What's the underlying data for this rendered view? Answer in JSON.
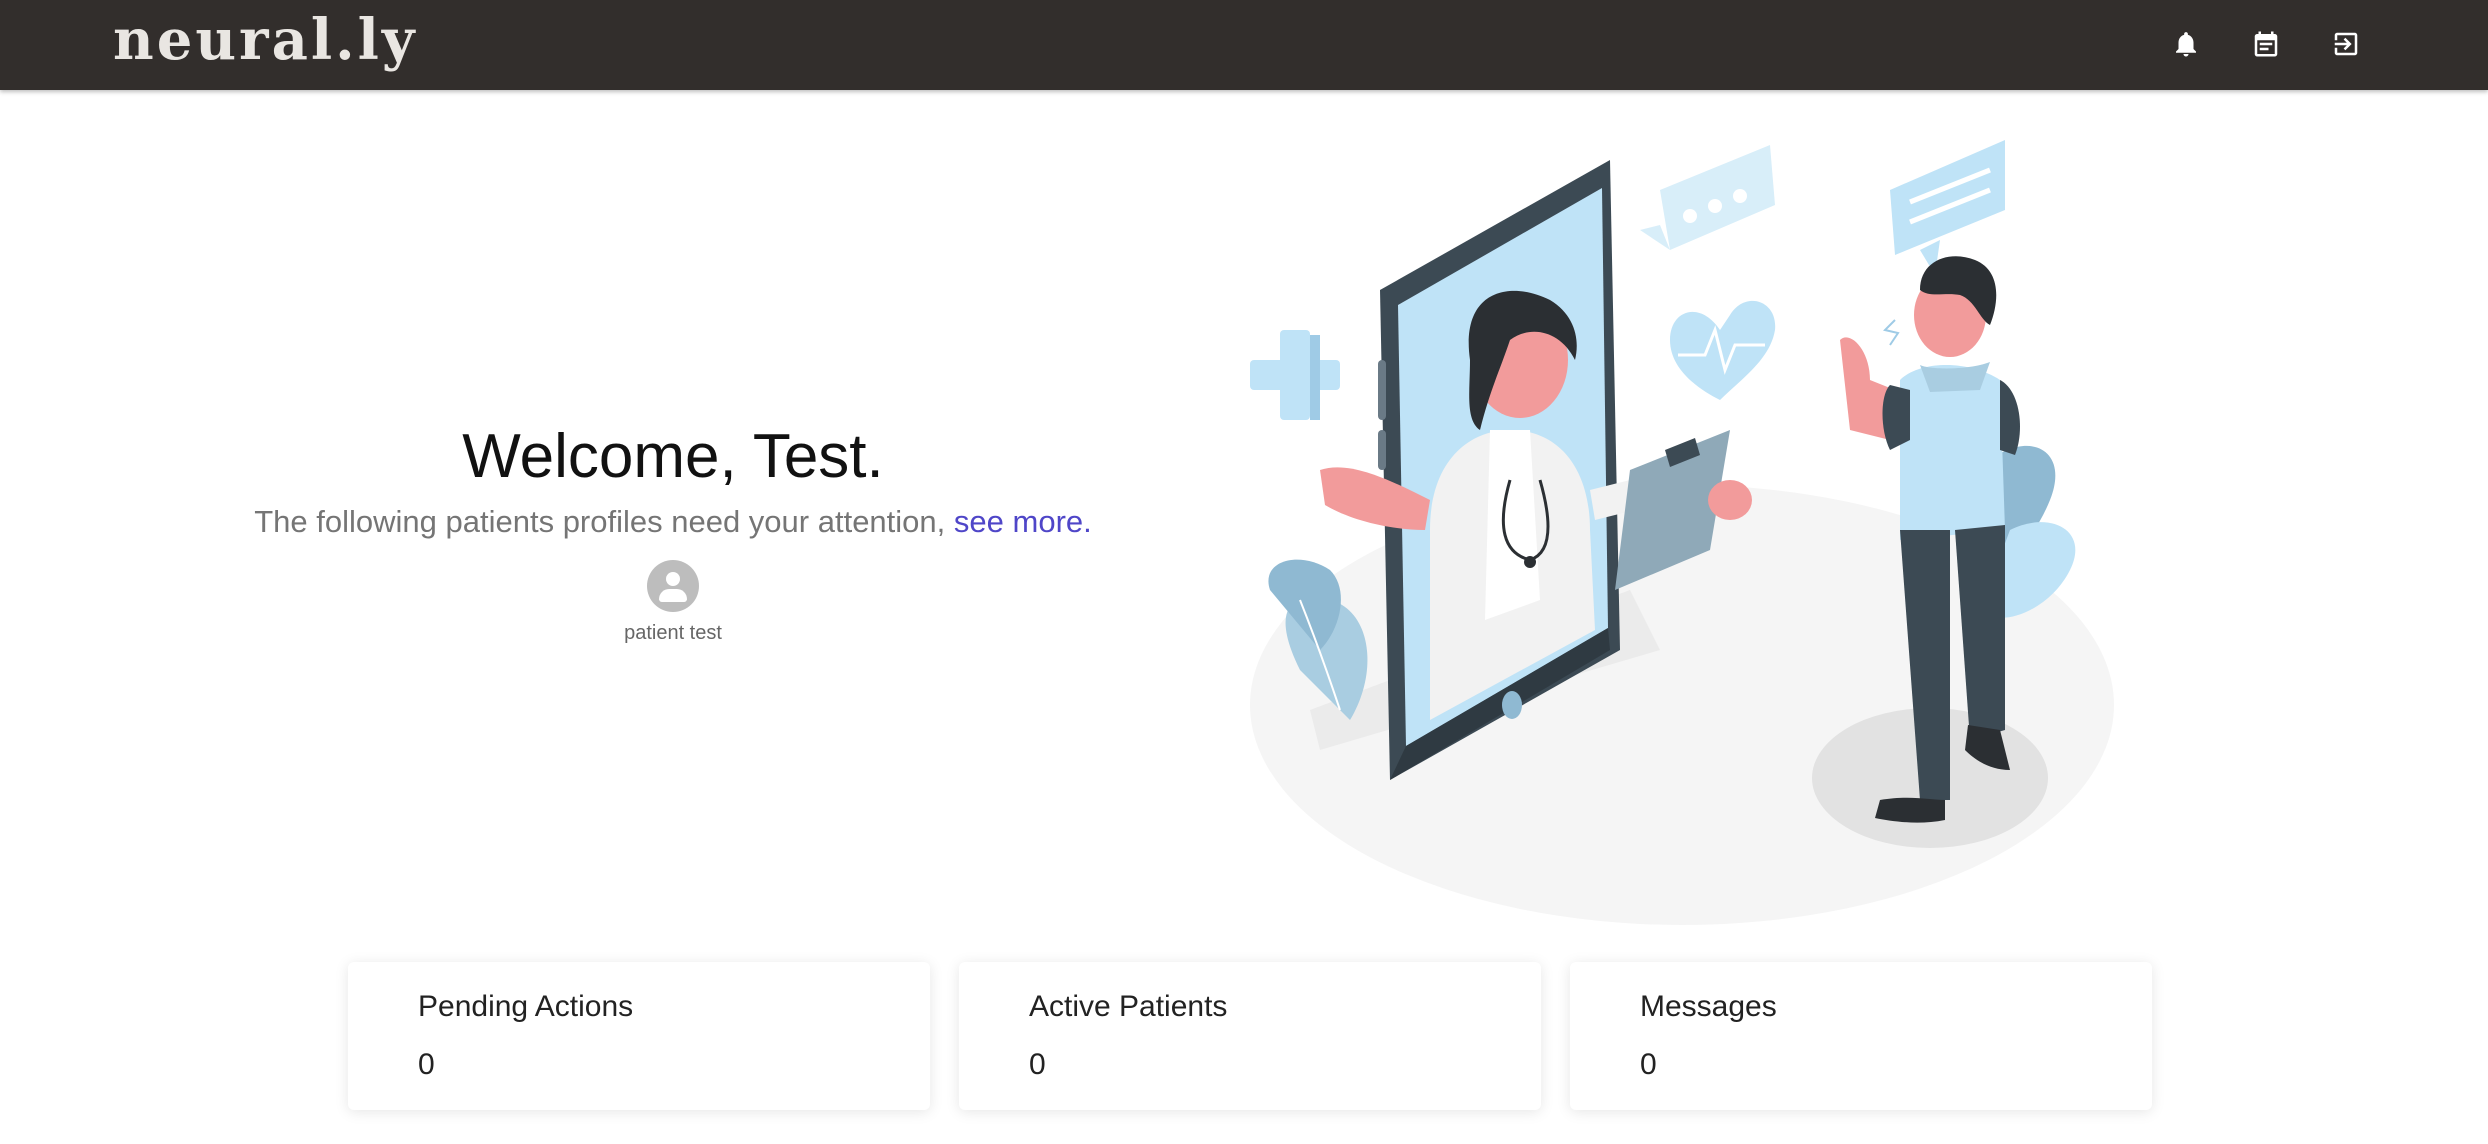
{
  "navbar": {
    "brand": "neural.ly",
    "icons": [
      "bell-icon",
      "calendar-icon",
      "logout-icon"
    ]
  },
  "welcome": {
    "title": "Welcome, Test.",
    "subtitle": "The following patients profiles need your attention,",
    "link": "see more."
  },
  "patients": [
    {
      "name": "patient test",
      "icon": "person-icon"
    }
  ],
  "illustration": {
    "icon": "telemedicine-illustration"
  },
  "stats": [
    {
      "title": "Pending Actions",
      "value": "0"
    },
    {
      "title": "Active Patients",
      "value": "0"
    },
    {
      "title": "Messages",
      "value": "0"
    }
  ],
  "colors": {
    "navbar": "#322e2c",
    "link": "#4f46c8",
    "accent_light_blue": "#bfe3f7",
    "dark_slate": "#3c4a54"
  }
}
